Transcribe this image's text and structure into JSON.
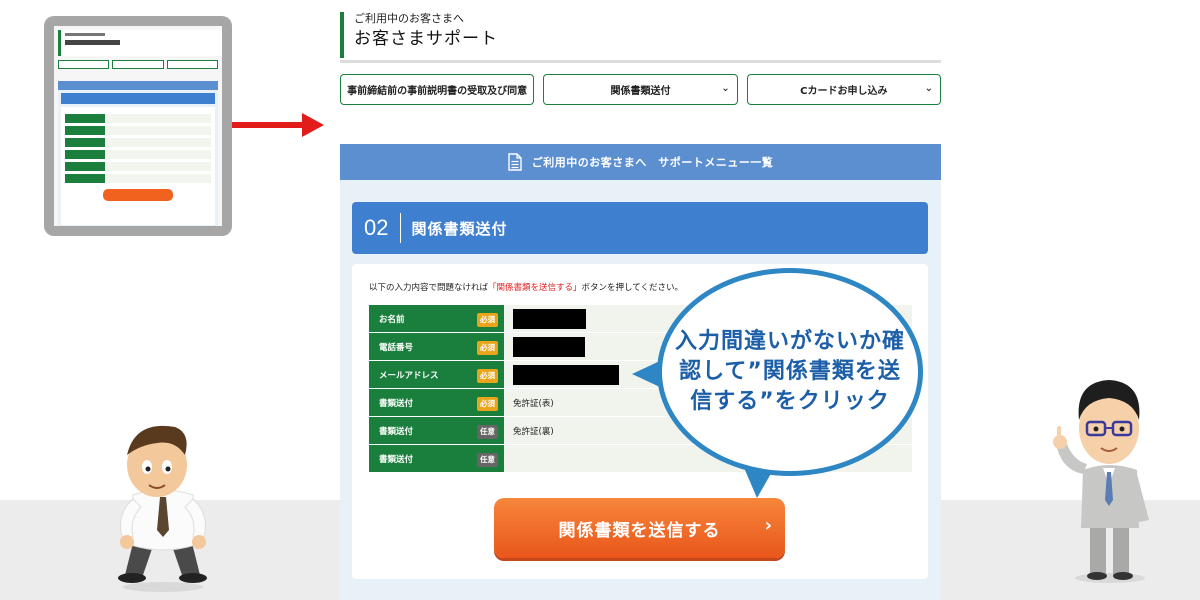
{
  "page": {
    "header_sub": "ご利用中のお客さまへ",
    "header_title": "お客さまサポート"
  },
  "tabs": [
    {
      "label": "事前締結前の事前説明書の受取及び同意"
    },
    {
      "label": "関係書類送付"
    },
    {
      "label": "Cカードお申し込み"
    }
  ],
  "banner": {
    "label": "ご利用中のお客さまへ　サポートメニュー一覧"
  },
  "section": {
    "number": "02",
    "title": "関係書類送付"
  },
  "instruction": {
    "before": "以下の入力内容で問題なければ",
    "highlight": "「関係書類を送信する」",
    "after": "ボタンを押してください。"
  },
  "form_rows": [
    {
      "label": "お名前",
      "badge": "必須",
      "value": "",
      "redacted": true
    },
    {
      "label": "電話番号",
      "badge": "必須",
      "value": "",
      "redacted": true
    },
    {
      "label": "メールアドレス",
      "badge": "必須",
      "value": "",
      "redacted": true
    },
    {
      "label": "書類送付",
      "badge": "必須",
      "value": "免許証(表)",
      "redacted": false
    },
    {
      "label": "書類送付",
      "badge": "任意",
      "value": "免許証(裏)",
      "redacted": false
    },
    {
      "label": "書類送付",
      "badge": "任意",
      "value": "",
      "redacted": false
    }
  ],
  "submit_button": {
    "label": "関係書類を送信する"
  },
  "callout": {
    "text": "入力間違いがないか確認して”関係書類を送信する”をクリック"
  },
  "colors": {
    "green": "#1a7f3c",
    "blue": "#3f7fcf",
    "orange": "#f0621e",
    "required_badge": "#e8a41b",
    "optional_badge": "#666666",
    "arrow_red": "#e21b1b"
  },
  "icons": [
    "document-icon",
    "chevron-down-icon",
    "chevron-right-icon"
  ]
}
